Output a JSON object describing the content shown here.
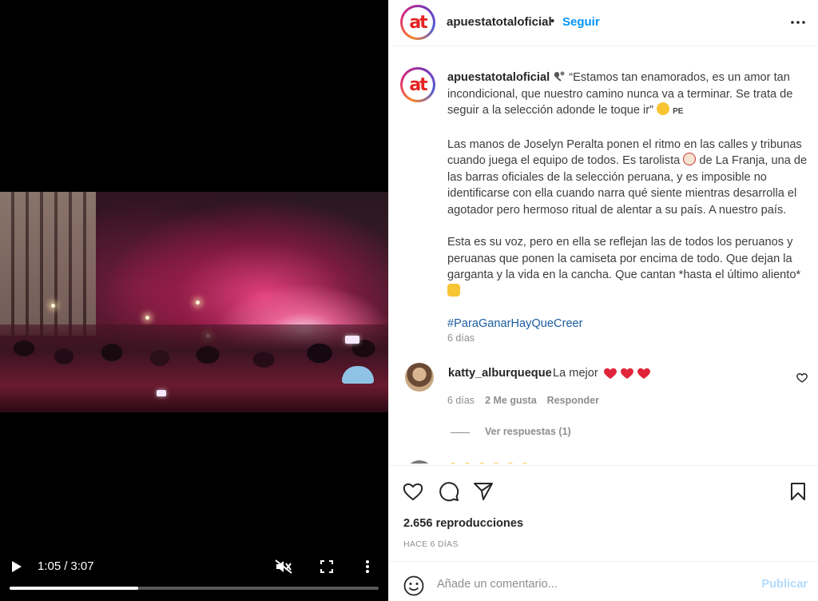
{
  "video": {
    "current_time": "1:05",
    "separator": "/",
    "duration": "3:07",
    "progress_fraction": 0.348
  },
  "header": {
    "username": "apuestatotaloficial",
    "dot": "•",
    "follow_label": "Seguir",
    "avatar_text": "at"
  },
  "caption": {
    "username": "apuestatotaloficial",
    "intro": "“Estamos tan enamorados, es un amor tan incondicional, que nuestro camino nunca va a terminar. Se trata de seguir a la selección adonde le toque ir”",
    "flag": "PE",
    "paragraph2a": "Las manos de Joselyn Peralta ponen el ritmo en las calles y tribunas cuando juega el equipo de todos. Es tarolista",
    "paragraph2b": "de La Franja, una de las barras oficiales de la selección peruana, y es imposible no identificarse con ella cuando narra qué siente mientras desarrolla el agotador pero hermoso ritual de alentar a su país. A nuestro país.",
    "paragraph3": "Esta es su voz, pero en ella se reflejan las de todos los peruanos y peruanas que ponen la camiseta por encima de todo. Que dejan la garganta y la vida en la cancha. Que cantan *hasta el último aliento*",
    "hashtag": "#ParaGanarHayQueCreer",
    "date": "6 días"
  },
  "comment": {
    "username": "katty_alburqueque",
    "text": "La mejor",
    "date": "6 días",
    "likes": "2 Me gusta",
    "reply_label": "Responder",
    "view_replies": "Ver respuestas (1)"
  },
  "actions": {
    "views": "2.656 reproducciones",
    "age": "HACE 6 DÍAS"
  },
  "compose": {
    "placeholder": "Añade un comentario...",
    "publish_label": "Publicar"
  },
  "colors": {
    "link_blue": "#0095f6",
    "hashtag_blue": "#1a5c9e",
    "brand_red": "#e62222",
    "muted": "#8e8e8e"
  },
  "icons": [
    "play-icon",
    "mute-icon",
    "fullscreen-icon",
    "more-vertical-icon",
    "more-horizontal-icon",
    "heart-icon",
    "comment-icon",
    "share-icon",
    "bookmark-icon",
    "emoji-icon"
  ]
}
